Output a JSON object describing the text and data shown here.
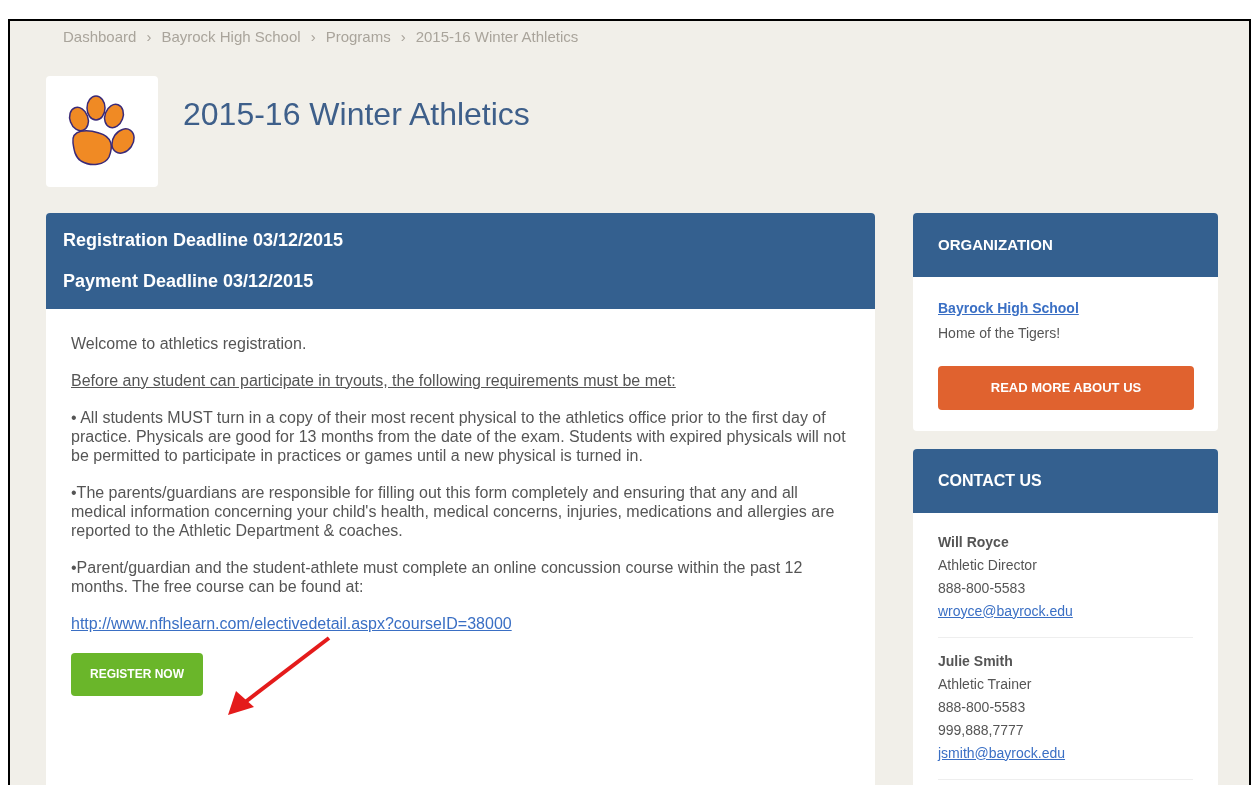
{
  "breadcrumb": [
    {
      "label": "Dashboard",
      "separator": "›"
    },
    {
      "label": "Bayrock High School",
      "separator": "›"
    },
    {
      "label": "Programs",
      "separator": "›"
    },
    {
      "label": "2015-16 Winter Athletics"
    }
  ],
  "page_title": "2015-16 Winter Athletics",
  "program_card": {
    "deadlines": [
      "Registration Deadline 03/12/2015",
      "Payment Deadline 03/12/2015"
    ],
    "paragraphs": [
      {
        "kind": "text",
        "text": "Welcome to athletics registration."
      },
      {
        "kind": "underlined",
        "text": "Before any student can participate in tryouts, the following requirements must be met:"
      },
      {
        "kind": "text",
        "text": "• All students MUST turn in a copy of their most recent physical to the athletics office prior to the first day of practice. Physicals are good for 13 months from the date of the exam. Students with expired physicals will not be permitted to participate in practices or games until a new physical is turned in."
      },
      {
        "kind": "text",
        "text": "•The parents/guardians are responsible for filling out this form completely and ensuring that any and all medical information concerning your child's health, medical concerns, injuries, medications and allergies are reported to the Athletic Department & coaches."
      },
      {
        "kind": "text",
        "text": "•Parent/guardian and the student-athlete must complete an online concussion course within the past 12 months. The free course can be found at:"
      },
      {
        "kind": "link",
        "text": "http://www.nfhslearn.com/electivedetail.aspx?courseID=38000"
      }
    ],
    "button": "REGISTER NOW"
  },
  "organization": {
    "title": "ORGANIZATION",
    "name": "Bayrock High School",
    "tagline": "Home of the Tigers!",
    "button": "READ MORE ABOUT US"
  },
  "contact": {
    "title": "CONTACT US",
    "people": [
      {
        "name": "Will Royce",
        "role": "Athletic Director",
        "phones": [
          "888-800-5583"
        ],
        "email": "wroyce@bayrock.edu"
      },
      {
        "name": "Julie Smith",
        "role": "Athletic Trainer",
        "phones": [
          "888-800-5583",
          "999,888,7777"
        ],
        "email": "jsmith@bayrock.edu"
      }
    ]
  }
}
